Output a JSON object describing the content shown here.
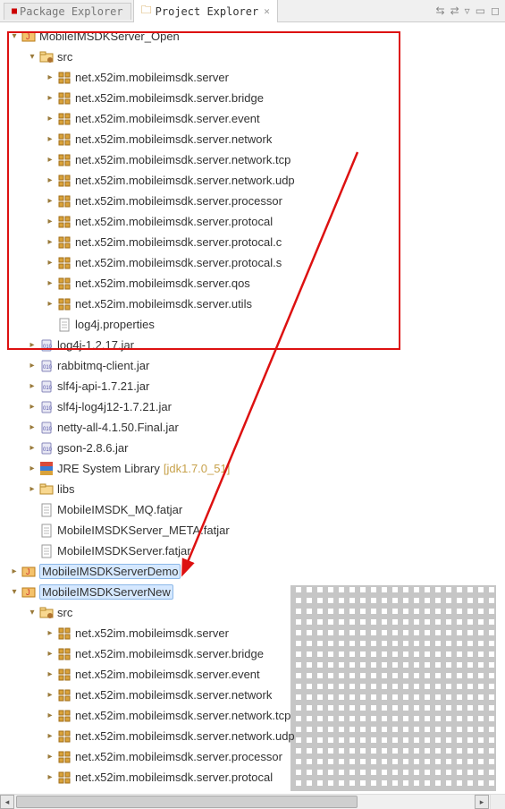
{
  "tabs": {
    "package_explorer": "Package Explorer",
    "project_explorer": "Project Explorer"
  },
  "tree": {
    "proj1": {
      "name": "MobileIMSDKServer_Open"
    },
    "src": "src",
    "packages1": [
      "net.x52im.mobileimsdk.server",
      "net.x52im.mobileimsdk.server.bridge",
      "net.x52im.mobileimsdk.server.event",
      "net.x52im.mobileimsdk.server.network",
      "net.x52im.mobileimsdk.server.network.tcp",
      "net.x52im.mobileimsdk.server.network.udp",
      "net.x52im.mobileimsdk.server.processor",
      "net.x52im.mobileimsdk.server.protocal",
      "net.x52im.mobileimsdk.server.protocal.c",
      "net.x52im.mobileimsdk.server.protocal.s",
      "net.x52im.mobileimsdk.server.qos",
      "net.x52im.mobileimsdk.server.utils"
    ],
    "log4j_prop": "log4j.properties",
    "jars": [
      "log4j-1.2.17.jar",
      "rabbitmq-client.jar",
      "slf4j-api-1.7.21.jar",
      "slf4j-log4j12-1.7.21.jar",
      "netty-all-4.1.50.Final.jar",
      "gson-2.8.6.jar"
    ],
    "jre": {
      "label": "JRE System Library",
      "extra": "[jdk1.7.0_51]"
    },
    "libs": "libs",
    "fatjars": [
      "MobileIMSDK_MQ.fatjar",
      "MobileIMSDKServer_META.fatjar",
      "MobileIMSDKServer.fatjar"
    ],
    "proj2": "MobileIMSDKServerDemo",
    "proj3": "MobileIMSDKServerNew",
    "packages3": [
      "net.x52im.mobileimsdk.server",
      "net.x52im.mobileimsdk.server.bridge",
      "net.x52im.mobileimsdk.server.event",
      "net.x52im.mobileimsdk.server.network",
      "net.x52im.mobileimsdk.server.network.tcp",
      "net.x52im.mobileimsdk.server.network.udp",
      "net.x52im.mobileimsdk.server.processor",
      "net.x52im.mobileimsdk.server.protocal"
    ]
  }
}
